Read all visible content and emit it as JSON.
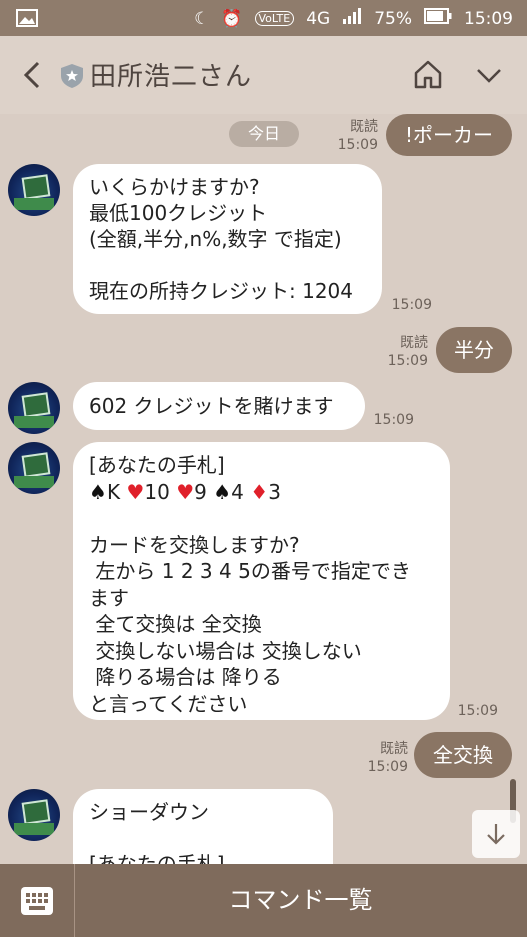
{
  "status_bar": {
    "battery": "75%",
    "time": "15:09",
    "network": "4G"
  },
  "header": {
    "title": "田所浩二さん"
  },
  "chat": {
    "date_label": "今日",
    "messages": [
      {
        "side": "out",
        "text": "!ポーカー",
        "read": "既読",
        "time": "15:09"
      },
      {
        "side": "in",
        "text": "いくらかけますか?\n最低100クレジット\n(全額,半分,n%,数字 で指定)\n\n現在の所持クレジット: 1204",
        "time": "15:09"
      },
      {
        "side": "out",
        "text": "半分",
        "read": "既読",
        "time": "15:09"
      },
      {
        "side": "in",
        "text": "602 クレジットを賭けます",
        "time": "15:09"
      },
      {
        "side": "in",
        "text": "[あなたの手札]\n♠K ♥10 ♥9 ♠4 ♦3\n\nカードを交換しますか?\n 左から 1 2 3 4 5の番号で指定でき\nます\n 全て交換は 全交換\n 交換しない場合は 交換しない\n 降りる場合は 降りる\nと言ってください",
        "time": "15:09"
      },
      {
        "side": "out",
        "text": "全交換",
        "read": "既読",
        "time": "15:09"
      },
      {
        "side": "in",
        "text": "ショーダウン\n\n[あなたの手札]",
        "time": ""
      }
    ]
  },
  "bottom_bar": {
    "command_label": "コマンド一覧"
  },
  "colors": {
    "chat_bg": "#d9cdc4",
    "outgoing_bubble": "#8a7564",
    "incoming_bubble": "#ffffff",
    "bottom_bar": "#7f6b5c"
  }
}
